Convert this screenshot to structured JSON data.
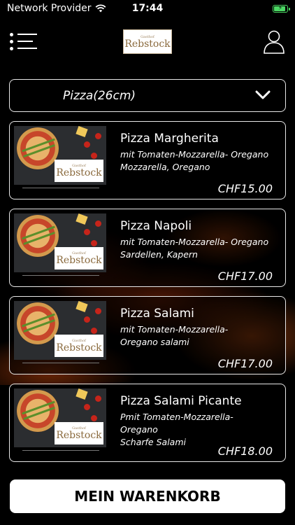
{
  "status_bar": {
    "carrier": "Network Provider",
    "time": "17:44",
    "battery_color": "#4cd964"
  },
  "header": {
    "logo_small": "Gasthof",
    "logo_text": "Rebstock",
    "menu_icon": "list-menu-icon",
    "user_icon": "user-profile-icon"
  },
  "category": {
    "selected": "Pizza(26cm)",
    "icon": "chevron-down-icon"
  },
  "products": [
    {
      "name": "Pizza Margherita",
      "desc_line1": "mit Tomaten-Mozzarella- Oregano",
      "desc_line2": "Mozzarella, Oregano",
      "price": "CHF15.00",
      "thumb_logo": "Rebstock"
    },
    {
      "name": "Pizza Napoli",
      "desc_line1": "mit Tomaten-Mozzarella- Oregano",
      "desc_line2": "Sardellen, Kapern",
      "price": "CHF17.00",
      "thumb_logo": "Rebstock"
    },
    {
      "name": "Pizza Salami",
      "desc_line1": "mit Tomaten-Mozzarella-",
      "desc_line2": "Oregano  salami",
      "price": "CHF17.00",
      "thumb_logo": "Rebstock"
    },
    {
      "name": "Pizza Salami Picante",
      "desc_line1": "Pmit Tomaten-Mozzarella- Oregano",
      "desc_line2": "Scharfe Salami",
      "price": "CHF18.00",
      "thumb_logo": "Rebstock"
    }
  ],
  "cart": {
    "label": "MEIN WARENKORB"
  },
  "colors": {
    "background": "#000000",
    "border": "#e8e8e8",
    "logo_brown": "#8a6a3d"
  }
}
